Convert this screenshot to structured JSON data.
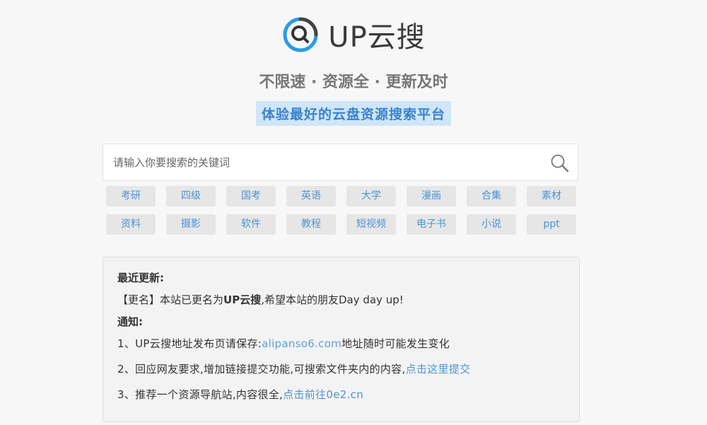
{
  "logo": {
    "text": "UP云搜",
    "icon": "magnifier-logo-icon"
  },
  "tagline": "不限速 · 资源全 · 更新及时",
  "slogan": "体验最好的云盘资源搜索平台",
  "search": {
    "placeholder": "请输入你要搜索的关键词",
    "value": "",
    "icon": "search-icon"
  },
  "tags": {
    "row1": [
      "考研",
      "四级",
      "国考",
      "英语",
      "大学",
      "漫画",
      "合集",
      "素材"
    ],
    "row2": [
      "资料",
      "摄影",
      "软件",
      "教程",
      "短视频",
      "电子书",
      "小说",
      "ppt"
    ]
  },
  "notice": {
    "recent_title": "最近更新:",
    "rename_prefix": "【更名】本站已更名为",
    "rename_name": "UP云搜",
    "rename_suffix": ",希望本站的朋友Day day up!",
    "notify_title": "通知:",
    "item1_prefix": "1、UP云搜地址发布页请保存:",
    "item1_link": "alipanso6.com",
    "item1_suffix": "地址随时可能发生变化",
    "item2_text": "2、回应网友要求,增加链接提交功能,可搜索文件夹内的内容,",
    "item2_link": "点击这里提交",
    "item3_text": "3、推荐一个资源导航站,内容很全,",
    "item3_link": "点击前往0e2.cn"
  },
  "colors": {
    "accent": "#4e93d6",
    "slogan_bg": "#cfe6f8",
    "logo_ring": "#2c9be8"
  }
}
